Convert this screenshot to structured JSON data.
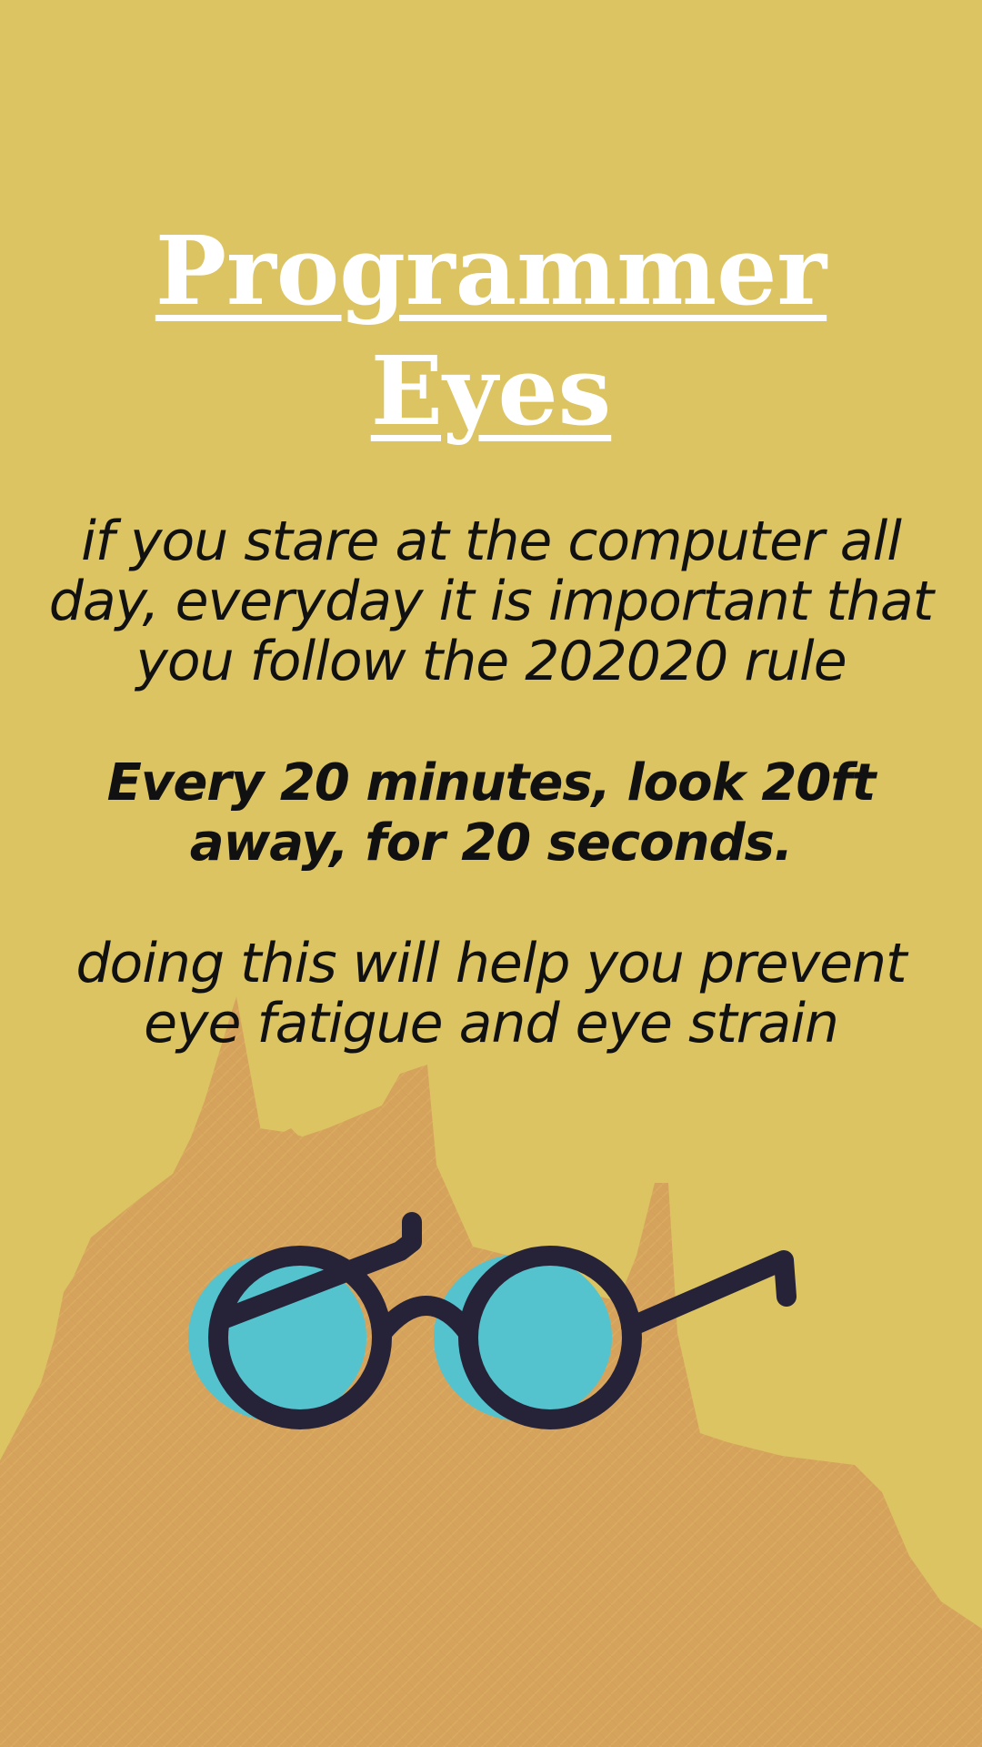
{
  "poster": {
    "title_line1": "Programmer",
    "title_line2": "Eyes",
    "intro": "if you stare at the computer all day, everyday it is important that you follow the 202020 rule",
    "rule": "Every 20 minutes, look 20ft away, for 20 seconds.",
    "outro": "doing this will help you prevent eye fatigue and eye strain"
  },
  "colors": {
    "background": "#dcc462",
    "hill": "#d6a35d",
    "lens": "#55c3cd",
    "frame": "#262339",
    "title": "#ffffff",
    "text": "#111111"
  },
  "icons": {
    "glasses": "glasses-icon",
    "hill": "hill-shape"
  }
}
